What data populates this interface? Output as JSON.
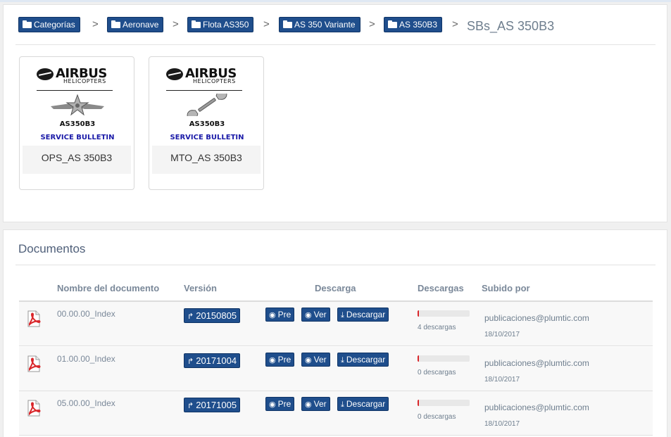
{
  "breadcrumb": {
    "items": [
      "Categorías",
      "Aeronave",
      "Flota AS350",
      "AS 350 Variante",
      "AS 350B3"
    ],
    "separator": ">",
    "current": "SBs_AS 350B3"
  },
  "cards": [
    {
      "brand": "AIRBUS",
      "brand_sub": "HELICOPTERS",
      "model": "AS350B3",
      "label": "SERVICE BULLETIN",
      "caption": "OPS_AS 350B3",
      "icon": "pilot-wings-icon"
    },
    {
      "brand": "AIRBUS",
      "brand_sub": "HELICOPTERS",
      "model": "AS350B3",
      "label": "SERVICE BULLETIN",
      "caption": "MTO_AS 350B3",
      "icon": "wrench-icon"
    }
  ],
  "documents": {
    "title": "Documentos",
    "columns": {
      "name": "Nombre del documento",
      "version": "Versión",
      "download": "Descarga",
      "downloads": "Descargas",
      "uploaded_by": "Subido por"
    },
    "buttons": {
      "pre": "Pre",
      "ver": "Ver",
      "descargar": "Descargar"
    },
    "rows": [
      {
        "name": "00.00.00_Index",
        "version": "20150805",
        "downloads": "4 descargas",
        "download_fraction": 0.03,
        "uploader": "publicaciones@plumtic.com",
        "date": "18/10/2017"
      },
      {
        "name": "01.00.00_Index",
        "version": "20171004",
        "downloads": "0 descargas",
        "download_fraction": 0.03,
        "uploader": "publicaciones@plumtic.com",
        "date": "18/10/2017"
      },
      {
        "name": "05.00.00_Index",
        "version": "20171005",
        "downloads": "0 descargas",
        "download_fraction": 0.03,
        "uploader": "publicaciones@plumtic.com",
        "date": "18/10/2017"
      }
    ]
  },
  "colors": {
    "primary": "#1f4e8c",
    "accent_red": "#d9262a",
    "muted_text": "#7a8899"
  }
}
